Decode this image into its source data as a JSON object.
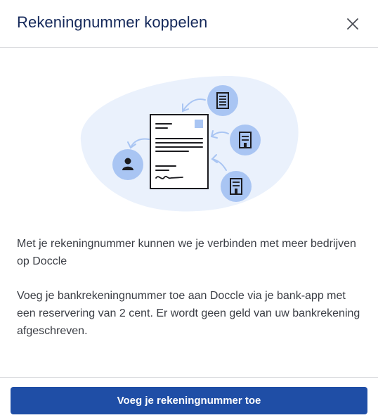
{
  "dialog": {
    "title": "Rekeningnummer koppelen",
    "close_icon": "close-icon"
  },
  "illustration": {
    "icons": [
      "document-icon",
      "person-icon",
      "building-icon",
      "building-icon",
      "building-icon",
      "signature-icon"
    ]
  },
  "content": {
    "paragraph_1": "Met je rekeningnummer kunnen we je verbinden met meer bedrijven op Doccle",
    "paragraph_2": "Voeg je bankrekeningnummer toe aan Doccle via je bank-app met een reservering van 2 cent. Er wordt geen geld van uw bankrekening afgeschreven."
  },
  "footer": {
    "primary_button_label": "Voeg je rekeningnummer toe"
  },
  "colors": {
    "title": "#14285a",
    "primary": "#1f4ea6",
    "illustration_bg": "#eaf1fc",
    "icon_circle": "#a9c5f3",
    "text": "#3a3d44"
  }
}
